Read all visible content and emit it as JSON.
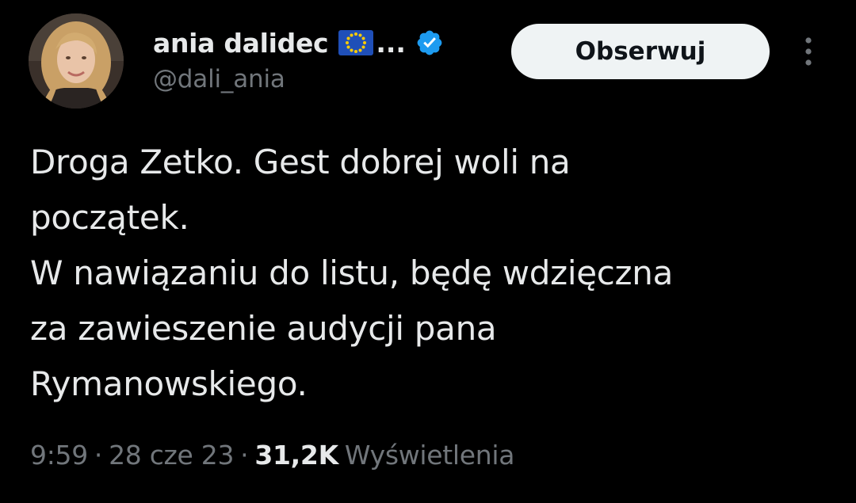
{
  "author": {
    "display_name": "ania dalidec",
    "flag_icon": "eu-flag-icon",
    "truncation": "...",
    "verified_icon": "verified-badge-icon",
    "handle": "@dali_ania"
  },
  "actions": {
    "follow_label": "Obserwuj",
    "more_icon": "more-vertical-icon"
  },
  "tweet": {
    "lines": [
      "Droga Zetko. Gest dobrej woli na",
      "początek.",
      "W nawiązaniu do listu, będę wdzięczna",
      "za zawieszenie audycji pana",
      "Rymanowskiego."
    ]
  },
  "meta": {
    "time": "9:59",
    "separator": "·",
    "date": "28 cze 23",
    "views_count": "31,2K",
    "views_label": "Wyświetlenia"
  },
  "colors": {
    "background": "#000000",
    "text_primary": "#e7e9ea",
    "text_secondary": "#71767b",
    "verified_blue": "#1d9bf0",
    "follow_bg": "#eff3f4"
  }
}
